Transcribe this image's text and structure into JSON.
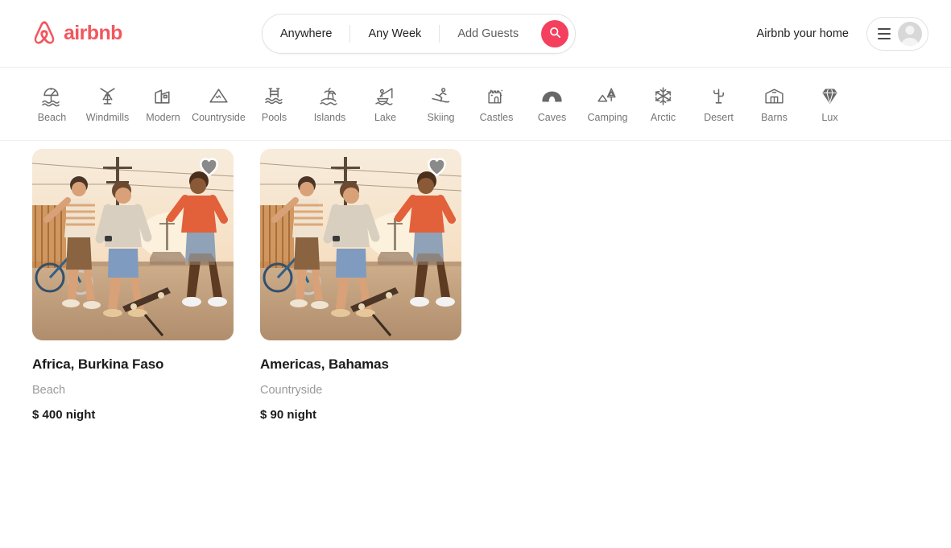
{
  "brand": {
    "name": "airbnb",
    "logo_icon": "airbnb-belo-icon",
    "color": "#F2575F"
  },
  "search": {
    "location": "Anywhere",
    "dates": "Any Week",
    "guests": "Add Guests",
    "search_icon": "search-icon",
    "button_color": "#F43F5E"
  },
  "header": {
    "host_link": "Airbnb your home",
    "menu_icon": "hamburger-icon",
    "avatar_icon": "user-avatar-icon"
  },
  "categories": [
    {
      "label": "Beach",
      "icon": "beach-umbrella-icon"
    },
    {
      "label": "Windmills",
      "icon": "windmill-icon"
    },
    {
      "label": "Modern",
      "icon": "modern-building-icon"
    },
    {
      "label": "Countryside",
      "icon": "mountain-icon"
    },
    {
      "label": "Pools",
      "icon": "pool-ladder-icon"
    },
    {
      "label": "Islands",
      "icon": "palm-island-icon"
    },
    {
      "label": "Lake",
      "icon": "fishing-boat-icon"
    },
    {
      "label": "Skiing",
      "icon": "skier-icon"
    },
    {
      "label": "Castles",
      "icon": "castle-icon"
    },
    {
      "label": "Caves",
      "icon": "cave-icon"
    },
    {
      "label": "Camping",
      "icon": "tent-tree-icon"
    },
    {
      "label": "Arctic",
      "icon": "snowflake-icon"
    },
    {
      "label": "Desert",
      "icon": "cactus-icon"
    },
    {
      "label": "Barns",
      "icon": "barn-icon"
    },
    {
      "label": "Lux",
      "icon": "diamond-icon"
    }
  ],
  "listings": [
    {
      "title": "Africa, Burkina Faso",
      "category": "Beach",
      "price": "$ 400 night",
      "favorite_icon": "heart-icon"
    },
    {
      "title": "Americas, Bahamas",
      "category": "Countryside",
      "price": "$ 90 night",
      "favorite_icon": "heart-icon"
    }
  ]
}
